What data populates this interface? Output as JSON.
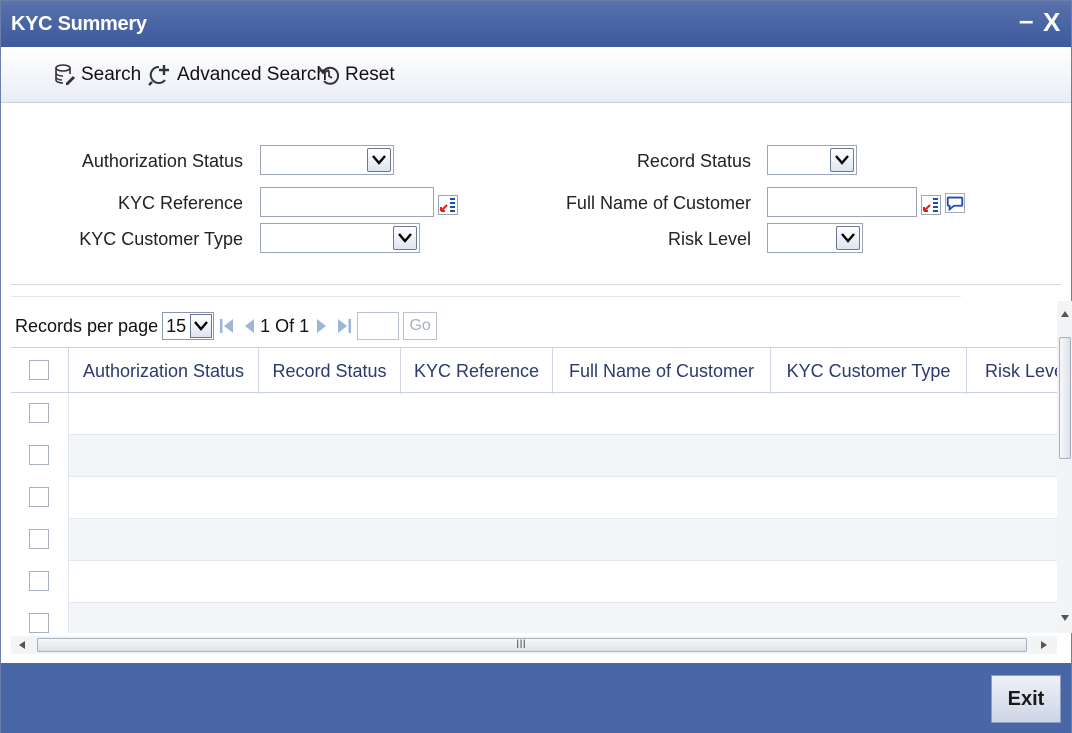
{
  "window": {
    "title": "KYC Summery",
    "minimize_glyph": "–",
    "close_glyph": "X"
  },
  "toolbar": {
    "search_label": "Search",
    "advanced_search_label": "Advanced Search",
    "reset_label": "Reset"
  },
  "criteria": {
    "authorization_status": {
      "label": "Authorization Status",
      "value": ""
    },
    "kyc_reference": {
      "label": "KYC Reference",
      "value": ""
    },
    "kyc_customer_type": {
      "label": "KYC Customer Type",
      "value": ""
    },
    "record_status": {
      "label": "Record Status",
      "value": ""
    },
    "full_name_of_customer": {
      "label": "Full Name of Customer",
      "value": ""
    },
    "risk_level": {
      "label": "Risk Level",
      "value": ""
    }
  },
  "pager": {
    "records_per_page_label": "Records per page",
    "records_per_page_value": "15",
    "page_indicator": "1 Of 1",
    "page_input_value": "",
    "go_label": "Go"
  },
  "grid": {
    "columns": [
      "Authorization Status",
      "Record Status",
      "KYC Reference",
      "Full Name of Customer",
      "KYC Customer Type",
      "Risk Leve"
    ],
    "row_count_visible": 6
  },
  "hscroll_marker": "III",
  "footer": {
    "exit_label": "Exit"
  },
  "colors": {
    "title_bar": "#4763a3",
    "footer": "#4a67a5",
    "header_text": "#2b3b6b"
  },
  "icons": {
    "search": "search-db-icon",
    "advanced_search": "advanced-search-icon",
    "reset": "reset-icon",
    "lov": "list-of-values-icon",
    "comment": "speech-bubble-icon"
  }
}
